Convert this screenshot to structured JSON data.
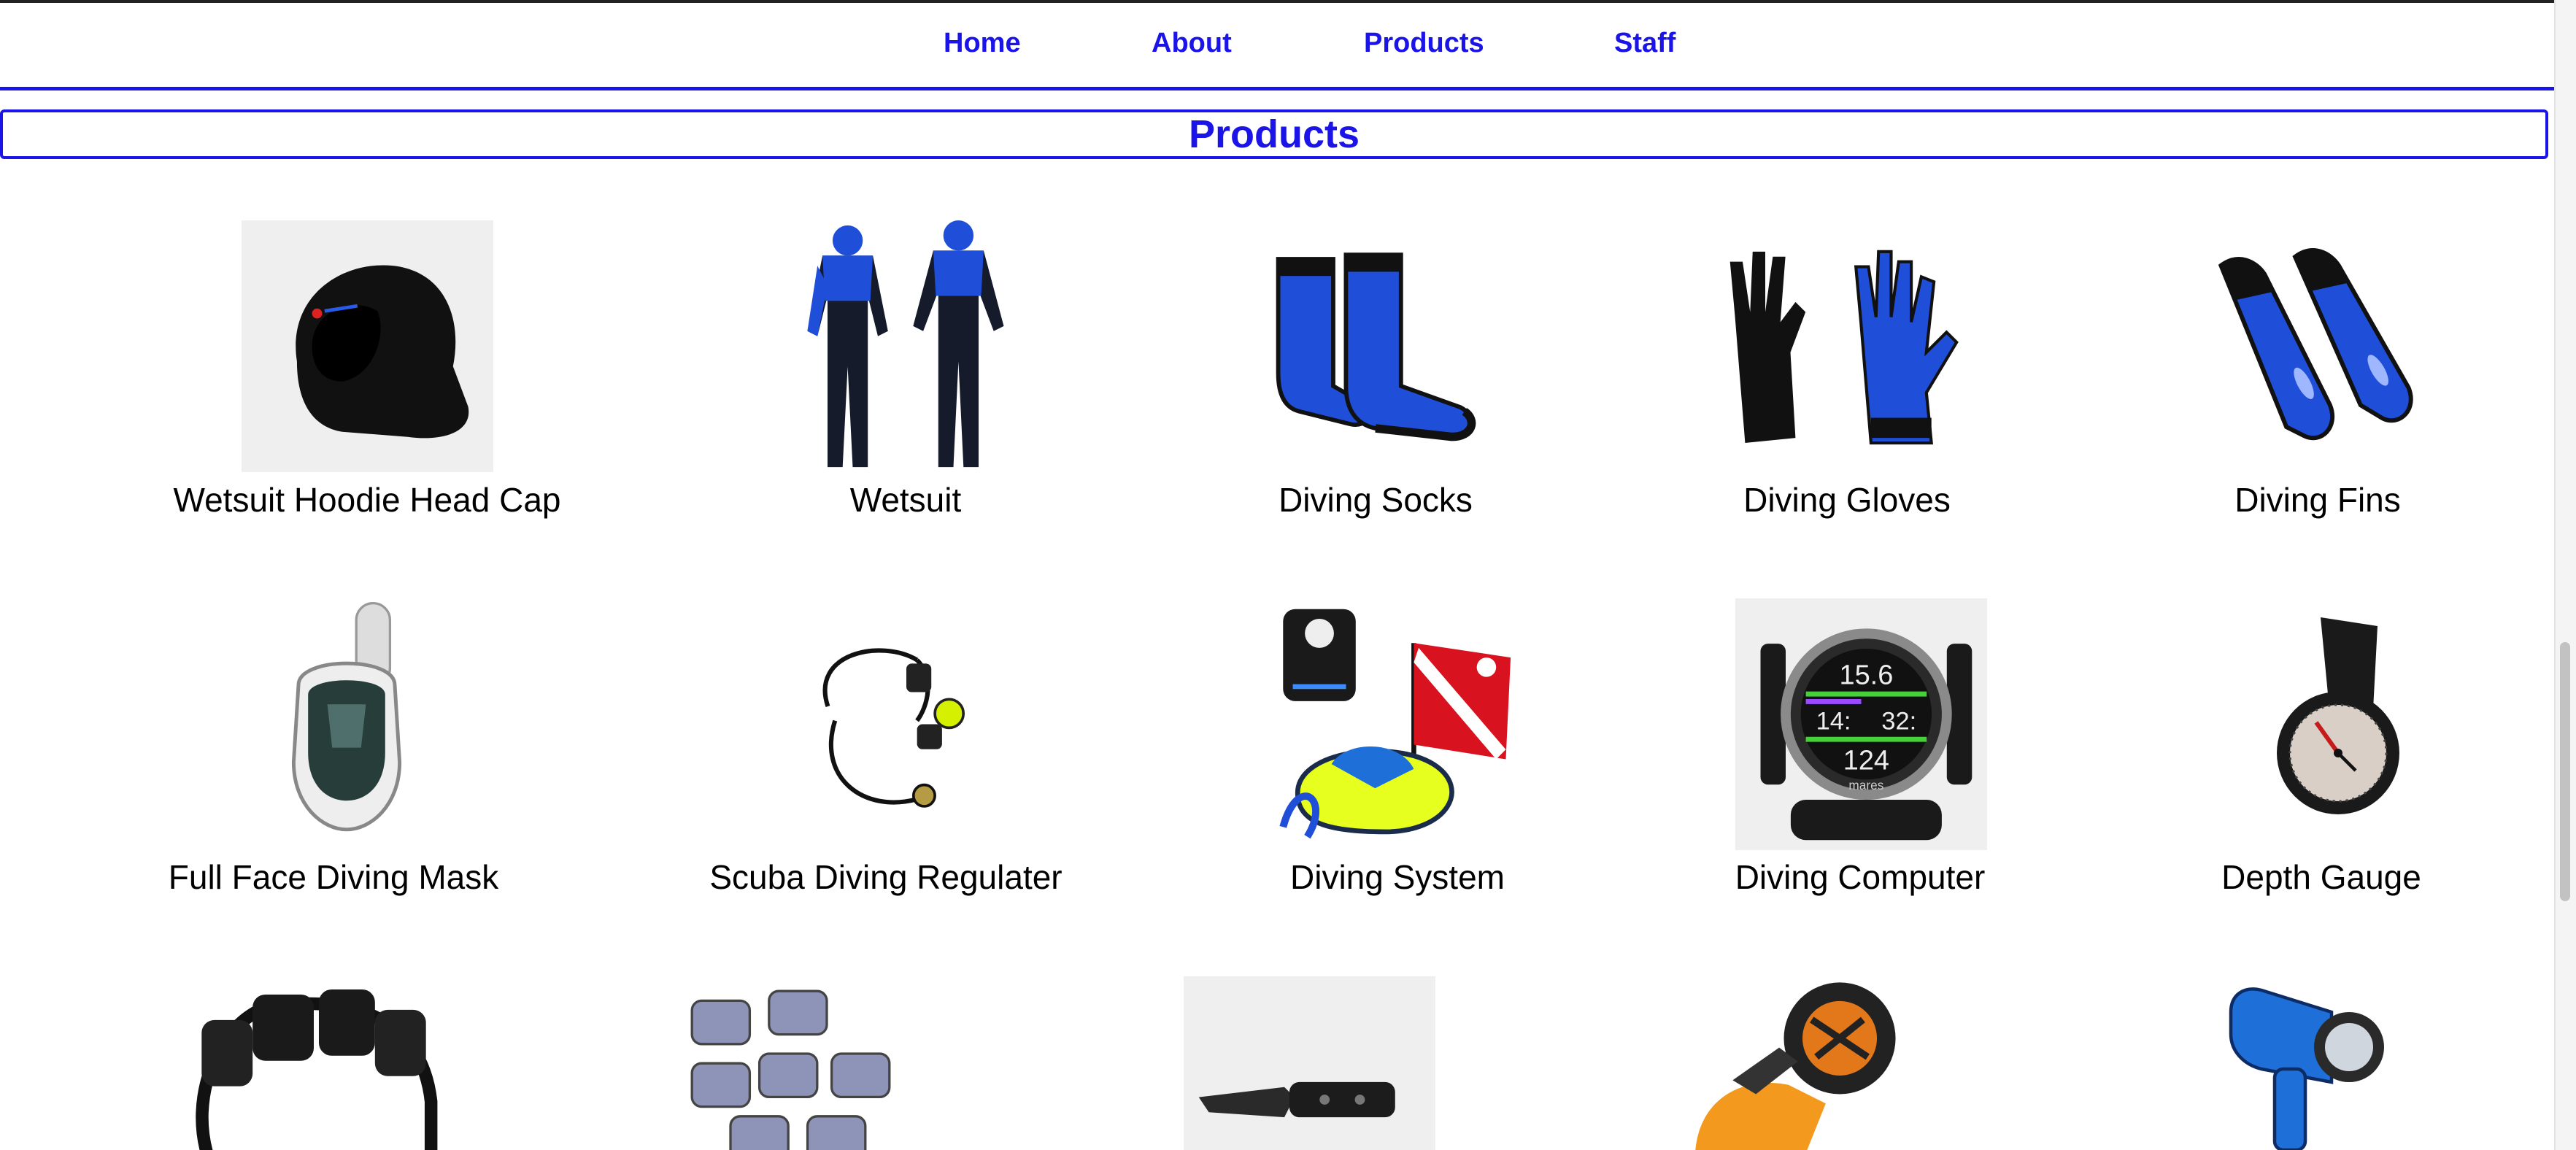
{
  "nav": {
    "items": [
      {
        "label": "Home"
      },
      {
        "label": "About"
      },
      {
        "label": "Products"
      },
      {
        "label": "Staff"
      }
    ]
  },
  "page": {
    "heading": "Products"
  },
  "products": [
    {
      "name": "Wetsuit Hoodie Head Cap",
      "icon": "hood-icon"
    },
    {
      "name": "Wetsuit",
      "icon": "wetsuit-icon"
    },
    {
      "name": "Diving Socks",
      "icon": "socks-icon"
    },
    {
      "name": "Diving Gloves",
      "icon": "gloves-icon"
    },
    {
      "name": "Diving Fins",
      "icon": "fins-icon"
    },
    {
      "name": "Full Face Diving Mask",
      "icon": "mask-icon"
    },
    {
      "name": "Scuba Diving Regulater",
      "icon": "regulator-icon"
    },
    {
      "name": "Diving System",
      "icon": "diving-system-icon"
    },
    {
      "name": "Diving Computer",
      "icon": "dive-computer-icon",
      "screen": [
        "15.6",
        "14:",
        "32:",
        "124"
      ],
      "brand": "mares"
    },
    {
      "name": "Depth Gauge",
      "icon": "depth-gauge-icon"
    },
    {
      "name": "",
      "icon": "weight-belt-icon"
    },
    {
      "name": "",
      "icon": "dive-weights-icon"
    },
    {
      "name": "",
      "icon": "dive-knife-icon"
    },
    {
      "name": "",
      "icon": "underwater-scooter-icon"
    },
    {
      "name": "",
      "icon": "dive-torch-icon"
    }
  ],
  "colors": {
    "accent": "#1a14e8",
    "product_blue": "#1f4fd8"
  }
}
